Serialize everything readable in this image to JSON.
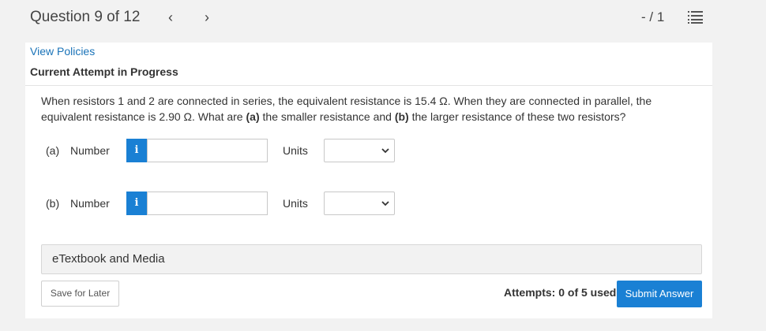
{
  "header": {
    "question_counter": "Question 9 of 12",
    "prev_glyph": "‹",
    "next_glyph": "›",
    "score": "- / 1",
    "list_icon": "question-list-icon"
  },
  "links": {
    "view_policies": "View Policies"
  },
  "attempt_status": "Current Attempt in Progress",
  "question": {
    "text_before_a": "When resistors 1 and 2 are connected in series, the equivalent resistance is 15.4 Ω. When they are connected in parallel, the equivalent resistance is 2.90 Ω. What are ",
    "part_a_marker": "(a)",
    "text_between": " the smaller resistance and ",
    "part_b_marker": "(b)",
    "text_after_b": " the larger resistance of these two resistors?"
  },
  "parts": [
    {
      "label": "(a)",
      "field_label": "Number",
      "info_glyph": "i",
      "value": "",
      "units_label": "Units",
      "units_selected": ""
    },
    {
      "label": "(b)",
      "field_label": "Number",
      "info_glyph": "i",
      "value": "",
      "units_label": "Units",
      "units_selected": ""
    }
  ],
  "etextbook": "eTextbook and Media",
  "footer": {
    "save_label": "Save for Later",
    "attempts_text": "Attempts: 0 of 5 used",
    "submit_label": "Submit Answer"
  },
  "colors": {
    "accent": "#1a80d4",
    "link": "#1a73b8",
    "background": "#f2f2f2",
    "card": "#ffffff"
  }
}
